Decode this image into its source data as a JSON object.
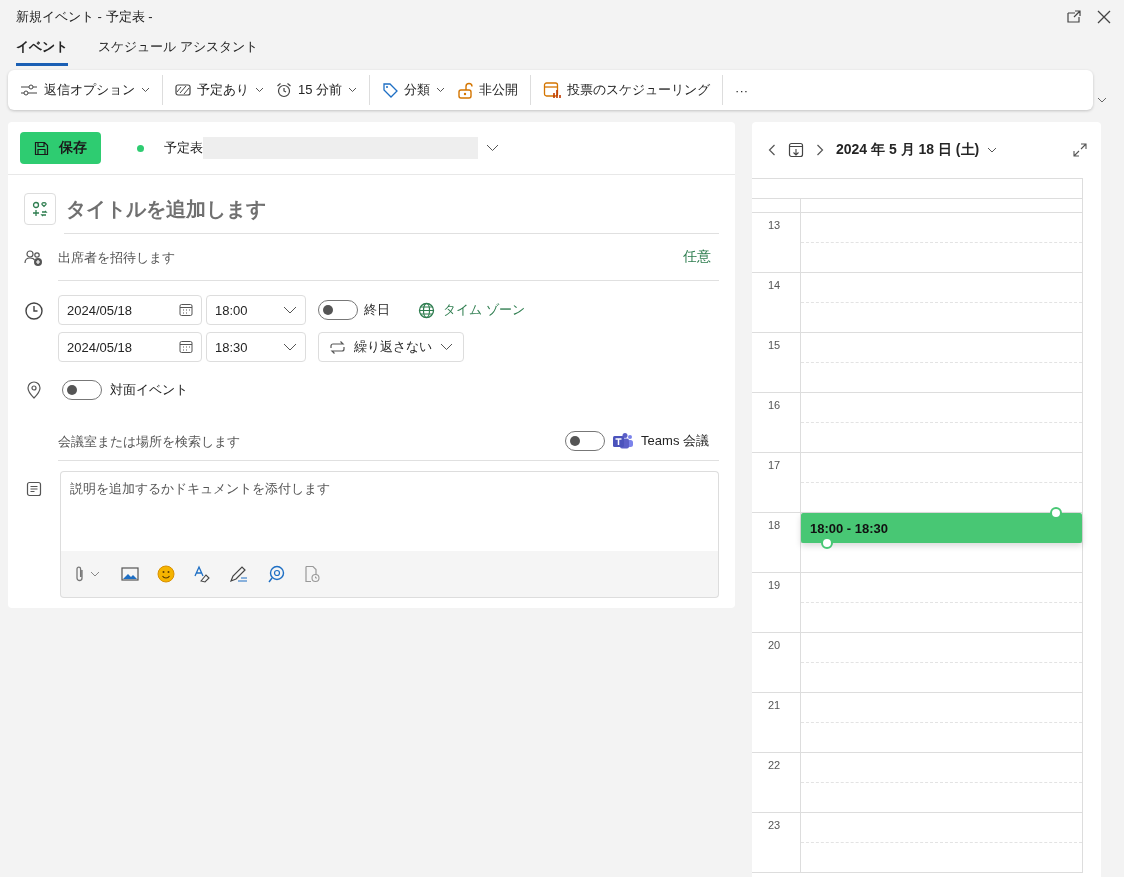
{
  "window": {
    "title": "新規イベント - 予定表 -"
  },
  "tabs": [
    {
      "label": "イベント",
      "selected": true
    },
    {
      "label": "スケジュール アシスタント",
      "selected": false
    }
  ],
  "toolbar": [
    [
      {
        "label": "返信オプション",
        "dropdown": true
      }
    ],
    [
      {
        "label": "予定あり",
        "dropdown": true
      },
      {
        "label": "15 分前",
        "dropdown": true
      }
    ],
    [
      {
        "label": "分類",
        "dropdown": true
      },
      {
        "label": "非公開",
        "dropdown": false
      }
    ],
    [
      {
        "label": "投票のスケジューリング",
        "dropdown": false
      }
    ],
    [
      {
        "label": "···",
        "dropdown": false
      }
    ]
  ],
  "form": {
    "save": "保存",
    "calendar": {
      "label": "予定表",
      "color": "#2ecc71"
    },
    "title": {
      "placeholder": "タイトルを追加します"
    },
    "attendees": {
      "placeholder": "出席者を招待します",
      "optional": "任意"
    },
    "start": {
      "date": "2024/05/18",
      "time": "18:00"
    },
    "end": {
      "date": "2024/05/18",
      "time": "18:30"
    },
    "all_day": {
      "label": "終日",
      "on": false
    },
    "timezone": "タイム ゾーン",
    "recurrence": "繰り返さない",
    "in_person": {
      "label": "対面イベント",
      "on": false
    },
    "location": {
      "placeholder": "会議室または場所を検索します"
    },
    "teams": {
      "label": "Teams 会議",
      "on": false
    },
    "description": {
      "placeholder": "説明を追加するかドキュメントを添付します"
    }
  },
  "day_view": {
    "date": "2024 年 5 月 18 日 (土)",
    "hours": [
      {
        "label": "13"
      },
      {
        "label": "14"
      },
      {
        "label": "15"
      },
      {
        "label": "16"
      },
      {
        "label": "17"
      },
      {
        "label": "18",
        "event": "18:00 - 18:30"
      },
      {
        "label": "19"
      },
      {
        "label": "20"
      },
      {
        "label": "21"
      },
      {
        "label": "22"
      },
      {
        "label": "23"
      }
    ]
  }
}
